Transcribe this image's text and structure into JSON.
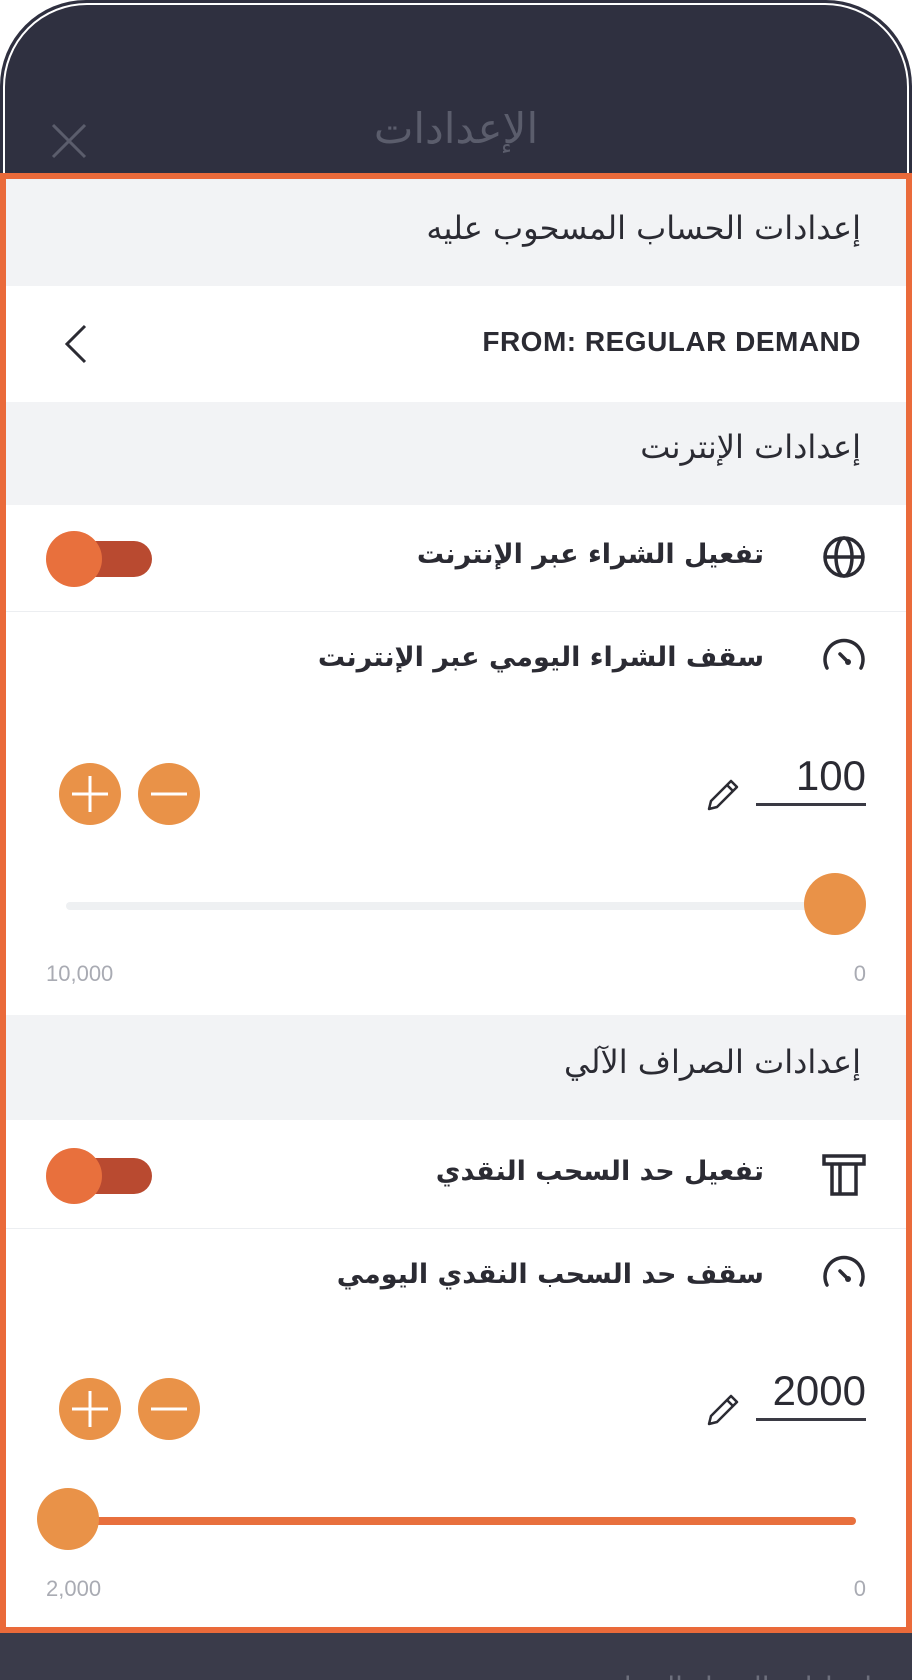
{
  "header": {
    "title": "الإعدادات",
    "close_icon": "close-icon"
  },
  "account_section": {
    "title": "إعدادات الحساب المسحوب عليه",
    "from_label": "FROM: REGULAR DEMAND"
  },
  "internet_section": {
    "title": "إعدادات الإنترنت",
    "enable_label": "تفعيل الشراء عبر الإنترنت",
    "enable_on": true,
    "limit_label": "سقف الشراء اليومي عبر الإنترنت",
    "limit_value": "100",
    "range_min": "0",
    "range_max": "10,000",
    "slider_fraction": 0.0
  },
  "atm_section": {
    "title": "إعدادات الصراف الآلي",
    "enable_label": "تفعيل حد السحب النقدي",
    "enable_on": true,
    "limit_label": "سقف حد السحب النقدي اليومي",
    "limit_value": "2000",
    "range_min": "0",
    "range_max": "2,000",
    "slider_fraction": 1.0
  },
  "bottom": {
    "partial_text": "إعدادات الشراء المحلية"
  },
  "colors": {
    "accent": "#e99248",
    "toggle_knob": "#e8703d",
    "toggle_track": "#b94a30",
    "frame": "#2f3040",
    "border": "#ea6a3a"
  }
}
